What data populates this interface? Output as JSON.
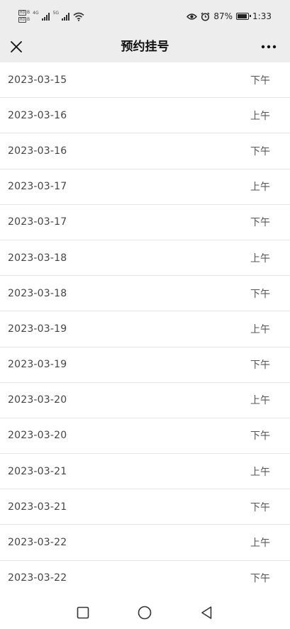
{
  "status_bar": {
    "sim1_label": "HD",
    "sim1_letter": "B",
    "sim2_label": "HD",
    "sim2_letter": "B",
    "net1": "4G",
    "net2": "5G",
    "battery_percent": "87%",
    "time": "1:33"
  },
  "nav": {
    "title": "预约挂号",
    "close_icon": "close-icon",
    "more_icon": "more-icon"
  },
  "slots": [
    {
      "date": "2023-03-15",
      "period": "下午"
    },
    {
      "date": "2023-03-16",
      "period": "上午"
    },
    {
      "date": "2023-03-16",
      "period": "下午"
    },
    {
      "date": "2023-03-17",
      "period": "上午"
    },
    {
      "date": "2023-03-17",
      "period": "下午"
    },
    {
      "date": "2023-03-18",
      "period": "上午"
    },
    {
      "date": "2023-03-18",
      "period": "下午"
    },
    {
      "date": "2023-03-19",
      "period": "上午"
    },
    {
      "date": "2023-03-19",
      "period": "下午"
    },
    {
      "date": "2023-03-20",
      "period": "上午"
    },
    {
      "date": "2023-03-20",
      "period": "下午"
    },
    {
      "date": "2023-03-21",
      "period": "上午"
    },
    {
      "date": "2023-03-21",
      "period": "下午"
    },
    {
      "date": "2023-03-22",
      "period": "上午"
    },
    {
      "date": "2023-03-22",
      "period": "下午"
    }
  ],
  "system_nav": {
    "recent_icon": "square-icon",
    "home_icon": "circle-icon",
    "back_icon": "triangle-back-icon"
  },
  "colors": {
    "header_bg": "#ededed",
    "divider": "#e6e6e6",
    "text": "#444444"
  }
}
